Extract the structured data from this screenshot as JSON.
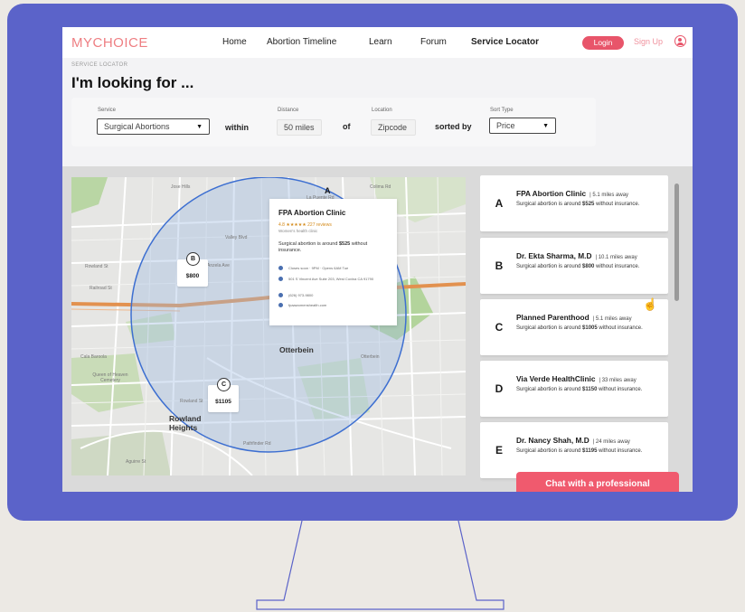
{
  "brand": {
    "logo": "MYCHOICE"
  },
  "nav": {
    "links": [
      "Home",
      "Abortion Timeline",
      "Learn",
      "Forum",
      "Service Locator"
    ],
    "login": "Login",
    "signup": "Sign Up"
  },
  "page": {
    "eyebrow": "SERVICE LOCATOR",
    "heading": "I'm looking for ..."
  },
  "filters": {
    "service_label": "Service",
    "service_value": "Surgical Abortions",
    "within": "within",
    "distance_label": "Distance",
    "distance_value": "50 miles",
    "of": "of",
    "location_label": "Location",
    "location_value": "Zipcode",
    "sorted_by": "sorted by",
    "sort_label": "Sort Type",
    "sort_value": "Price"
  },
  "map": {
    "streets": [
      "Jose Hills",
      "Valley Blvd",
      "Anzela Ave",
      "Railroad St",
      "Rowland St",
      "Pathfinder Rd",
      "La Puente Rd",
      "Colima Rd",
      "Otterbein",
      "Cala Baroola",
      "Aguirre St",
      "Rowland St"
    ],
    "places": [
      "Otterbein",
      "Rowland Heights",
      "Queen of Heaven Cemetery"
    ],
    "markers": [
      {
        "letter": "B",
        "price": "$800"
      },
      {
        "letter": "C",
        "price": "$1105"
      }
    ],
    "popup": {
      "letter": "A",
      "title": "FPA Abortion Clinic",
      "rating": "4.8 ★★★★★ 227 reviews",
      "subtitle": "Women's health clinic",
      "desc_prefix": "Surgical abortion is around ",
      "desc_price": "$525",
      "desc_suffix": " without insurance.",
      "hours": "Closes soon · 9PM · Opens 6AM Tue",
      "address": "501 S Vincent Ave Suite 203, West Covina CA 91790",
      "phone": "(626) 973-9800",
      "website": "fpaawomenshealth.com"
    }
  },
  "results": [
    {
      "letter": "A",
      "name": "FPA Abortion Clinic",
      "distance": "|   5.1 miles away",
      "prefix": "Surgical abortion is around ",
      "price": "$525",
      "suffix": " without insurance."
    },
    {
      "letter": "B",
      "name": "Dr. Ekta Sharma, M.D",
      "distance": "|   10.1 miles away",
      "prefix": "Surgical abortion is around ",
      "price": "$800",
      "suffix": " without insurance."
    },
    {
      "letter": "C",
      "name": "Planned Parenthood",
      "distance": "|   5.1 miles away",
      "prefix": "Surgical abortion is around ",
      "price": "$1005",
      "suffix": " without insurance."
    },
    {
      "letter": "D",
      "name": "Via Verde HealthClinic",
      "distance": "|   33 miles away",
      "prefix": "Surgical abortion is around ",
      "price": "$1150",
      "suffix": " without insurance."
    },
    {
      "letter": "E",
      "name": "Dr. Nancy Shah, M.D",
      "distance": "|   24 miles away",
      "prefix": "Surgical abortion is around ",
      "price": "$1195",
      "suffix": " without insurance."
    }
  ],
  "chat": {
    "label": "Chat with a professional"
  },
  "colors": {
    "frame": "#5b63c9",
    "accent": "#e8556a",
    "logo": "#ee7e82"
  }
}
